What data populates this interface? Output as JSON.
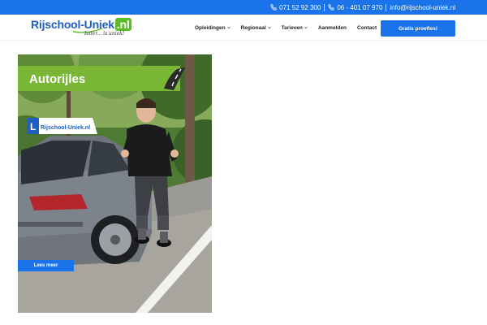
{
  "topbar": {
    "phone1": "071 52 92 300",
    "phone2": "06 - 401 07 970",
    "email": "info@rijschool-uniek.nl"
  },
  "logo": {
    "name_main": "Rijschool-Uniek",
    "name_tld": ".nl",
    "tagline": "Ieder... is uniek!"
  },
  "nav": {
    "items": [
      {
        "label": "Opleidingen",
        "dropdown": true
      },
      {
        "label": "Regionaal",
        "dropdown": true
      },
      {
        "label": "Tarieven",
        "dropdown": true
      },
      {
        "label": "Aanmelden",
        "dropdown": false
      },
      {
        "label": "Contact",
        "dropdown": false
      }
    ],
    "cta_label": "Gratis proefles!"
  },
  "card": {
    "title": "Autorijles",
    "read_more": "Lees meer",
    "roof_sign_text": "Rijschool-Uniek.nl",
    "roof_sign_letter": "L"
  },
  "colors": {
    "brand_blue": "#1a73e8",
    "brand_green": "#7ab737"
  }
}
